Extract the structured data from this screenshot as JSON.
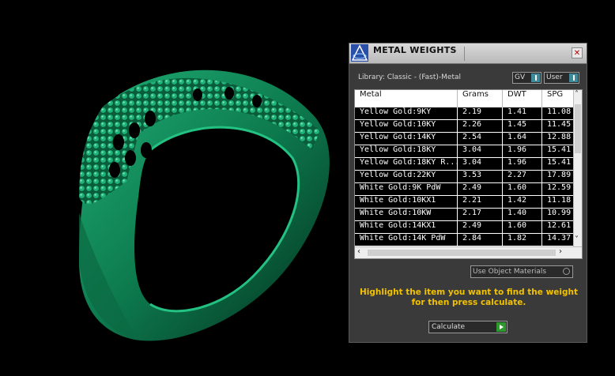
{
  "panel": {
    "title": "METAL WEIGHTS",
    "close_label": "✕",
    "library_label": "Library: Classic - (Fast)-Metal",
    "toggles": {
      "gv_label": "GV",
      "user_label": "User"
    },
    "table": {
      "headers": [
        "Metal",
        "Grams",
        "DWT",
        "SPG"
      ],
      "rows": [
        [
          "Yellow Gold:9KY",
          "2.19",
          "1.41",
          "11.08"
        ],
        [
          "Yellow Gold:10KY",
          "2.26",
          "1.45",
          "11.45"
        ],
        [
          "Yellow Gold:14KY",
          "2.54",
          "1.64",
          "12.88"
        ],
        [
          "Yellow Gold:18KY",
          "3.04",
          "1.96",
          "15.41"
        ],
        [
          "Yellow Gold:18KY R...",
          "3.04",
          "1.96",
          "15.41"
        ],
        [
          "Yellow Gold:22KY",
          "3.53",
          "2.27",
          "17.89"
        ],
        [
          "White Gold:9K PdW",
          "2.49",
          "1.60",
          "12.59"
        ],
        [
          "White Gold:10KX1",
          "2.21",
          "1.42",
          "11.18"
        ],
        [
          "White Gold:10KW",
          "2.17",
          "1.40",
          "10.99"
        ],
        [
          "White Gold:14KX1",
          "2.49",
          "1.60",
          "12.61"
        ],
        [
          "White Gold:14K PdW",
          "2.84",
          "1.82",
          "14.37"
        ]
      ]
    },
    "use_object_materials_label": "Use Object Materials",
    "hint_text": "Highlight the item you want to find the weight for then press calculate.",
    "calculate_label": "Calculate"
  },
  "colors": {
    "ring_green": "#0f8a5a",
    "hint_yellow": "#f2c200",
    "panel_bg": "#3a3a3a"
  }
}
